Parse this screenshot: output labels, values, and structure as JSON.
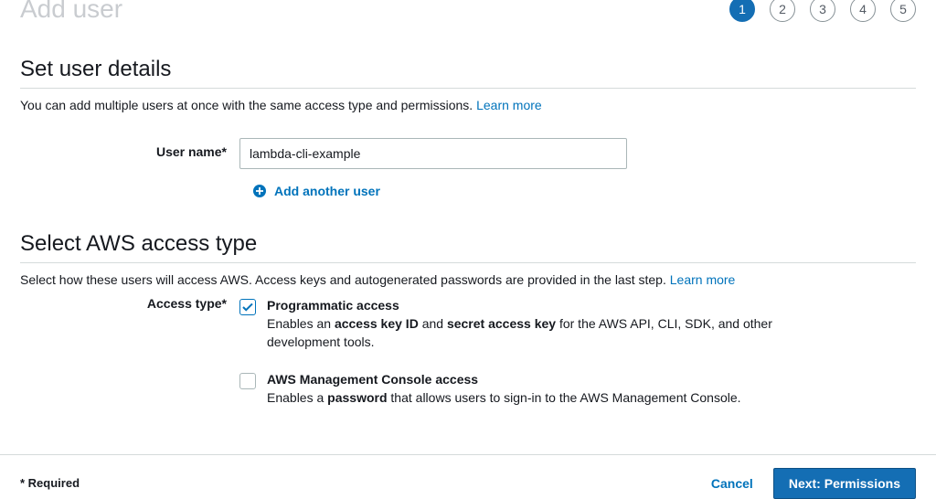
{
  "header": {
    "page_title": "Add user",
    "steps": [
      "1",
      "2",
      "3",
      "4",
      "5"
    ],
    "active_step_index": 0
  },
  "set_user_details": {
    "title": "Set user details",
    "description_prefix": "You can add multiple users at once with the same access type and permissions.",
    "learn_more": "Learn more",
    "user_name_label": "User name*",
    "user_name_value": "lambda-cli-example",
    "add_another": "Add another user"
  },
  "access_type": {
    "title": "Select AWS access type",
    "description_prefix": "Select how these users will access AWS. Access keys and autogenerated passwords are provided in the last step.",
    "learn_more": "Learn more",
    "form_label": "Access type*",
    "options": [
      {
        "checked": true,
        "title": "Programmatic access",
        "desc_before": "Enables an ",
        "desc_bold1": "access key ID",
        "desc_middle": " and ",
        "desc_bold2": "secret access key",
        "desc_after": " for the AWS API, CLI, SDK, and other development tools."
      },
      {
        "checked": false,
        "title": "AWS Management Console access",
        "desc_before": "Enables a ",
        "desc_bold1": "password",
        "desc_middle": "",
        "desc_bold2": "",
        "desc_after": " that allows users to sign-in to the AWS Management Console."
      }
    ]
  },
  "footer": {
    "required": "* Required",
    "cancel": "Cancel",
    "next": "Next: Permissions"
  }
}
